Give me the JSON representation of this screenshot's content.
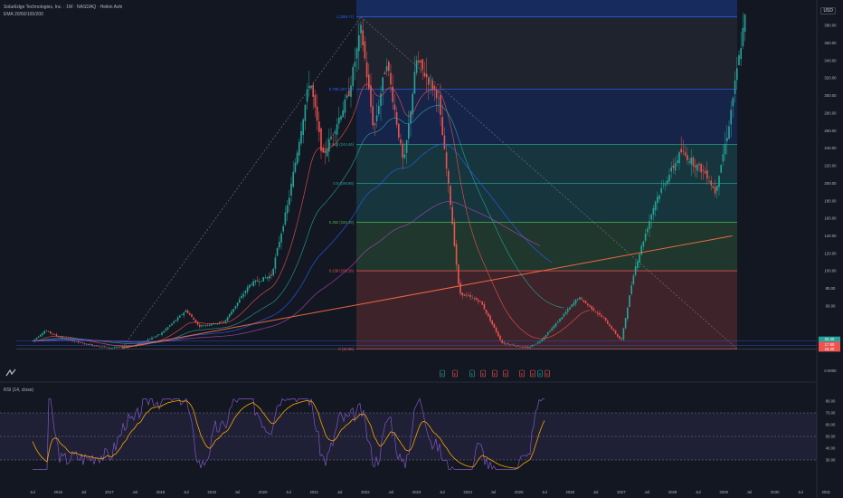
{
  "header": {
    "title": "SolarEdge Technologies, Inc. · 1W · NASDAQ · Heikin Ashi",
    "indicator": "EMA 20/50/100/200",
    "currency": "USD",
    "rsi_label": "RSI (14, close)"
  },
  "colors": {
    "background": "#131722",
    "bull": "#26a69a",
    "bear": "#ef5350",
    "rsi": "#7e57c2",
    "rsi_ma": "#f7a600",
    "trendline": "#ff7043"
  },
  "chart_data": [
    {
      "type": "candlestick",
      "title": "SolarEdge Technologies, Inc. · 1W · NASDAQ · Heikin Ashi",
      "x_ticks": [
        "Jul",
        "2016",
        "Jul",
        "2017",
        "Jul",
        "2018",
        "Jul",
        "2019",
        "Jul",
        "2020",
        "Jul",
        "2021",
        "Jul",
        "2022",
        "Jul",
        "2023",
        "Jul",
        "2024",
        "Jul",
        "2025",
        "Jul",
        "2026",
        "Jul",
        "2027",
        "Jul",
        "2028",
        "Jul",
        "2029",
        "Jul",
        "2030",
        "Jul",
        "2031"
      ],
      "y_ticks": [
        380,
        360,
        340,
        320,
        300,
        280,
        260,
        240,
        220,
        200,
        180,
        160,
        140,
        120,
        100,
        80,
        60
      ],
      "y_range": [
        0,
        390
      ],
      "price_series": [
        {
          "date": "2015-07",
          "price": 20
        },
        {
          "date": "2015-10",
          "price": 32
        },
        {
          "date": "2016-01",
          "price": 25
        },
        {
          "date": "2016-07",
          "price": 17
        },
        {
          "date": "2017-01",
          "price": 12
        },
        {
          "date": "2017-07",
          "price": 15
        },
        {
          "date": "2018-01",
          "price": 28
        },
        {
          "date": "2018-07",
          "price": 55
        },
        {
          "date": "2018-10",
          "price": 37
        },
        {
          "date": "2019-04",
          "price": 42
        },
        {
          "date": "2019-10",
          "price": 85
        },
        {
          "date": "2020-03",
          "price": 95
        },
        {
          "date": "2020-07",
          "price": 180
        },
        {
          "date": "2020-12",
          "price": 320
        },
        {
          "date": "2021-03",
          "price": 230
        },
        {
          "date": "2021-09",
          "price": 300
        },
        {
          "date": "2021-12",
          "price": 376
        },
        {
          "date": "2022-03",
          "price": 260
        },
        {
          "date": "2022-06",
          "price": 340
        },
        {
          "date": "2022-10",
          "price": 220
        },
        {
          "date": "2023-01",
          "price": 340
        },
        {
          "date": "2023-06",
          "price": 300
        },
        {
          "date": "2023-09",
          "price": 175
        },
        {
          "date": "2023-11",
          "price": 75
        },
        {
          "date": "2024-04",
          "price": 65
        },
        {
          "date": "2024-09",
          "price": 18
        },
        {
          "date": "2025-03",
          "price": 12
        },
        {
          "date": "2025-06",
          "price": 20
        },
        {
          "date": "2025-09",
          "price": 36
        },
        {
          "date": "2026-03",
          "price": 70
        },
        {
          "date": "2026-09",
          "price": 45
        },
        {
          "date": "2027-01",
          "price": 20
        },
        {
          "date": "2027-04",
          "price": 100
        },
        {
          "date": "2027-09",
          "price": 180
        },
        {
          "date": "2028-03",
          "price": 236
        },
        {
          "date": "2028-09",
          "price": 210
        },
        {
          "date": "2028-11",
          "price": 190
        },
        {
          "date": "2029-02",
          "price": 260
        },
        {
          "date": "2029-06",
          "price": 389
        }
      ],
      "fib_levels": [
        {
          "ratio": "1",
          "label": "1 (389.77)",
          "price": 389.77,
          "color": "#2962ff"
        },
        {
          "ratio": "0.786",
          "label": "0.786 (307.32)",
          "price": 307.32,
          "color": "#2962ff"
        },
        {
          "ratio": "0.618",
          "label": "0.618 (244.46)",
          "price": 244.46,
          "color": "#26a69a"
        },
        {
          "ratio": "0.5",
          "label": "0.5 (199.88)",
          "price": 199.88,
          "color": "#26a69a"
        },
        {
          "ratio": "0.382",
          "label": "0.382 (155.39)",
          "price": 155.39,
          "color": "#4caf50"
        },
        {
          "ratio": "0.236",
          "label": "0.236 (100.16)",
          "price": 100.16,
          "color": "#ef5350"
        },
        {
          "ratio": "0",
          "label": "0 (10.98)",
          "price": 10.98,
          "color": "#ef5350"
        }
      ],
      "price_labels": {
        "last": "22.40",
        "mid": "17.80",
        "low": "15.20",
        "base": "0.0000"
      },
      "event_markers": [
        "E",
        "E",
        "E",
        "E",
        "E",
        "E",
        "E",
        "E",
        "E",
        "E"
      ]
    },
    {
      "type": "line",
      "title": "RSI (14, close)",
      "y_ticks": [
        80,
        70,
        60,
        50,
        40,
        30
      ],
      "y_range": [
        25,
        85
      ],
      "bands": {
        "upper": 70,
        "middle": 50,
        "lower": 30
      }
    }
  ]
}
